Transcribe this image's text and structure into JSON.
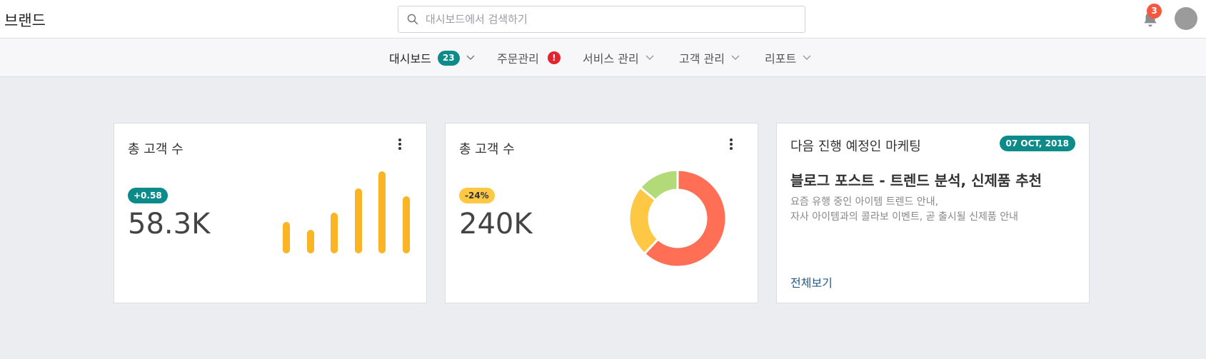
{
  "header": {
    "brand": "브랜드",
    "search_placeholder": "대시보드에서 검색하기",
    "search_value": "",
    "notifications_count": "3"
  },
  "nav": [
    {
      "label": "대시보드",
      "count": "23",
      "active": true
    },
    {
      "label": "주문관리",
      "alert": "!"
    },
    {
      "label": "서비스 관리"
    },
    {
      "label": "고객 관리"
    },
    {
      "label": "리포트"
    }
  ],
  "cards": {
    "customers_bar": {
      "title": "총 고객 수",
      "delta": "+0.58",
      "value": "58.3K",
      "bar_values": [
        40,
        30,
        52,
        83,
        105,
        73
      ],
      "bar_color": "#fbb424"
    },
    "customers_donut": {
      "title": "총 고객 수",
      "delta": "-24%",
      "value": "240K",
      "segments": [
        {
          "value": 62,
          "color": "#ff6f55"
        },
        {
          "value": 24,
          "color": "#ffc844"
        },
        {
          "value": 14,
          "color": "#b3da78"
        }
      ]
    },
    "marketing": {
      "title": "다음 진행 예정인 마케팅",
      "date": "07 OCT, 2018",
      "post_title": "블로그 포스트 - 트렌드 분석, 신제품 추천",
      "desc_line1": "요즘 유행 중인 아이템 트렌드 안내,",
      "desc_line2": "자사 아이템과의 콜라보 이벤트, 곧 출시될 신제품 안내",
      "link": "전체보기"
    }
  },
  "colors": {
    "teal": "#0d8a8a",
    "alert_red": "#e5222d",
    "badge_orange": "#f4593f",
    "delta_yellow": "#ffc844",
    "link_blue": "#1f5a86"
  }
}
